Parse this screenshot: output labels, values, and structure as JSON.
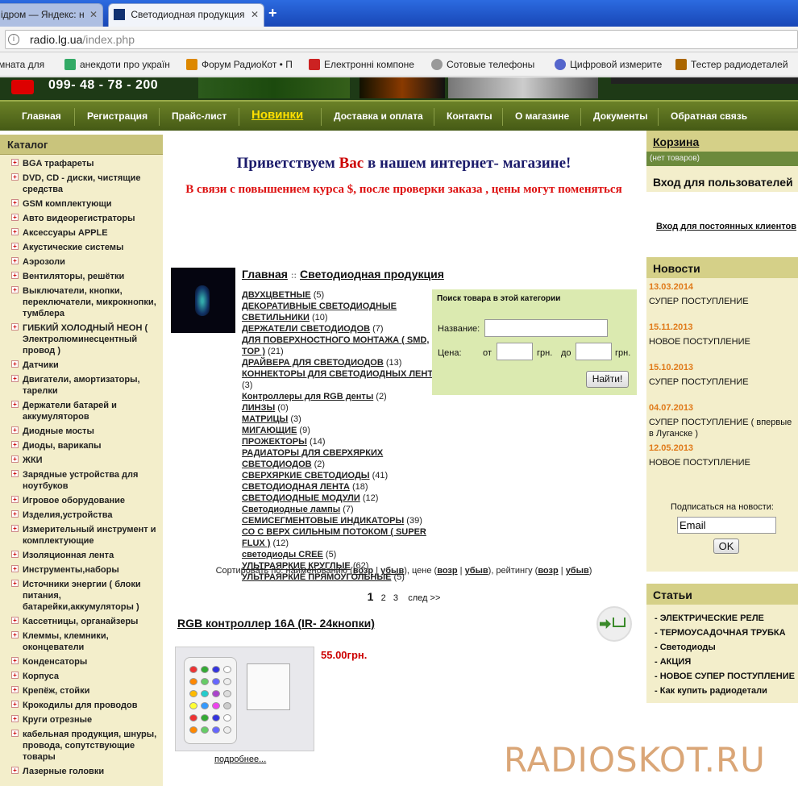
{
  "browser": {
    "tabs": [
      {
        "title": "ідром — Яндекс: н"
      },
      {
        "title": "Светодиодная продукция"
      }
    ],
    "url": "radio.lg.ua",
    "url_path": "/index.php",
    "bookmarks": [
      {
        "label": "мната для"
      },
      {
        "label": "анекдоти про україн"
      },
      {
        "label": "Форум РадиоКот • П"
      },
      {
        "label": "Електронні компоне"
      },
      {
        "label": "Сотовые телефоны"
      },
      {
        "label": "Цифровой измерите"
      },
      {
        "label": "Тестер радиодеталей"
      }
    ]
  },
  "header": {
    "phone": "099- 48 - 78 - 200"
  },
  "nav": [
    {
      "label": "Главная"
    },
    {
      "label": "Регистрация"
    },
    {
      "label": "Прайс-лист"
    },
    {
      "label": "Новинки"
    },
    {
      "label": "Доставка и оплата"
    },
    {
      "label": "Контакты"
    },
    {
      "label": "О магазине"
    },
    {
      "label": "Документы"
    },
    {
      "label": "Обратная связь"
    }
  ],
  "catalog": {
    "title": "Каталог",
    "items": [
      "BGA трафареты",
      "DVD, CD - диски, чистящие средства",
      "GSM комплектующи",
      "Авто видеорегистраторы",
      "Аксессуары APPLE",
      "Акустические системы",
      "Аэрозоли",
      "Вентиляторы, решётки",
      "Выключатели, кнопки, переключатели, микрокнопки, тумблера",
      "ГИБКИЙ ХОЛОДНЫЙ НЕОН ( Электролюминесцентный провод )",
      "Датчики",
      "Двигатели, амортизаторы, тарелки",
      "Держатели батарей и аккумуляторов",
      "Диодные мосты",
      "Диоды, варикапы",
      "ЖКИ",
      "Зарядные устройства для ноутбуков",
      "Игровое оборудование",
      "Изделия,устройства",
      "Измерительный инструмент и комплектующие",
      "Изоляционная лента",
      "Инструменты,наборы",
      "Источники энергии ( блоки питания, батарейки,аккумуляторы )",
      "Кассетницы, органайзеры",
      "Клеммы, клемники, оконцеватели",
      "Конденсаторы",
      "Корпуса",
      "Крепёж, стойки",
      "Крокодилы для проводов",
      "Круги отрезные",
      "кабельная продукция, шнуры, провода, сопутствующие товары",
      "Лазерные головки"
    ]
  },
  "welcome": {
    "part1": "Приветствуем ",
    "part2": "Вас",
    "part3": " в нашем интернет- магазине!"
  },
  "notice": "В связи с повышением курса $, после проверки заказа , цены могут поменяться",
  "breadcrumb": {
    "home": "Главная",
    "sep": "::",
    "current": "Светодиодная продукция"
  },
  "subcategories": [
    {
      "name": "ДВУХЦВЕТНЫЕ",
      "count": "(5)"
    },
    {
      "name": "ДЕКОРАТИВНЫЕ СВЕТОДИОДНЫЕ СВЕТИЛЬНИКИ",
      "count": "(10)"
    },
    {
      "name": "ДЕРЖАТЕЛИ СВЕТОДИОДОВ",
      "count": "(7)"
    },
    {
      "name": "ДЛЯ ПОВЕРХНОСТНОГО МОНТАЖА ( SMD, ТОР )",
      "count": "(21)"
    },
    {
      "name": "ДРАЙВЕРА ДЛЯ СВЕТОДИОДОВ",
      "count": "(13)"
    },
    {
      "name": "КОННЕКТОРЫ ДЛЯ СВЕТОДИОДНЫХ ЛЕНТ",
      "count": "(3)"
    },
    {
      "name": "Контроллеры для RGB денты",
      "count": "(2)"
    },
    {
      "name": "ЛИНЗЫ",
      "count": "(0)"
    },
    {
      "name": "МАТРИЦЫ",
      "count": "(3)"
    },
    {
      "name": "МИГАЮЩИЕ",
      "count": "(9)"
    },
    {
      "name": "ПРОЖЕКТОРЫ",
      "count": "(14)"
    },
    {
      "name": "РАДИАТОРЫ ДЛЯ СВЕРХЯРКИХ СВЕТОДИОДОВ",
      "count": "(2)"
    },
    {
      "name": "СВЕРХЯРКИЕ СВЕТОДИОДЫ",
      "count": "(41)"
    },
    {
      "name": "СВЕТОДИОДНАЯ ЛЕНТА",
      "count": "(18)"
    },
    {
      "name": "СВЕТОДИОДНЫЕ МОДУЛИ",
      "count": "(12)"
    },
    {
      "name": "Светодиодные лампы",
      "count": "(7)"
    },
    {
      "name": "СЕМИСЕГМЕНТОВЫЕ ИНДИКАТОРЫ",
      "count": "(39)"
    },
    {
      "name": "СО С ВЕРХ СИЛЬНЫМ ПОТОКОМ ( SUPER FLUX )",
      "count": "(12)"
    },
    {
      "name": "светодиоды CREE",
      "count": "(5)"
    },
    {
      "name": "УЛЬТРАЯРКИЕ КРУГЛЫЕ",
      "count": "(62)"
    },
    {
      "name": "УЛЬТРАЯРКИЕ ПРЯМОУГОЛЬНЫЕ",
      "count": "(5)"
    }
  ],
  "search": {
    "title": "Поиск товара в этой категории",
    "name_label": "Название:",
    "price_label": "Цена:",
    "from_label": "от",
    "to_label": "до",
    "currency": "грн.",
    "button": "Найти!"
  },
  "sort": {
    "prefix": "Сортировать по: наименованию (",
    "asc": "возр",
    "sep": " | ",
    "desc": "убыв",
    "price": "), цене (",
    "rating": "), рейтингу (",
    "end": ")"
  },
  "pagination": {
    "current": "1",
    "p2": "2",
    "p3": "3",
    "next": "след >>"
  },
  "product": {
    "title": "RGB контроллер 16A (IR- 24кнопки)",
    "price": "55.00грн.",
    "more": "подробнее..."
  },
  "cart": {
    "title": "Корзина",
    "empty": "(нет товаров)"
  },
  "login": {
    "title": "Вход для пользователей",
    "link": "Вход для постоянных клиентов"
  },
  "news": {
    "title": "Новости",
    "items": [
      {
        "date": "13.03.2014",
        "text": "СУПЕР ПОСТУПЛЕНИЕ"
      },
      {
        "date": "15.11.2013",
        "text": "НОВОЕ ПОСТУПЛЕНИЕ"
      },
      {
        "date": "15.10.2013",
        "text": "СУПЕР ПОСТУПЛЕНИЕ"
      },
      {
        "date": "04.07.2013",
        "text": "СУПЕР ПОСТУПЛЕНИЕ ( впервые в Луганске )"
      },
      {
        "date": "12.05.2013",
        "text": "НОВОЕ ПОСТУПЛЕНИЕ"
      }
    ],
    "subscribe_label": "Подписаться на новости:",
    "email_value": "Email",
    "ok": "OK"
  },
  "articles": {
    "title": "Статьи",
    "items": [
      "- ЭЛЕКТРИЧЕСКИЕ РЕЛЕ",
      "- ТЕРМОУСАДОЧНАЯ ТРУБКА",
      "- Светодиоды",
      "- АКЦИЯ",
      "- НОВОЕ СУПЕР ПОСТУПЛЕНИЕ",
      "- Как купить радиодетали"
    ]
  },
  "watermark": "RADIOSKOT.RU",
  "colors": {
    "nav": "#556b1e",
    "sidebar": "#f3eecb",
    "price": "#cc0000",
    "news_date": "#e07a1a"
  }
}
